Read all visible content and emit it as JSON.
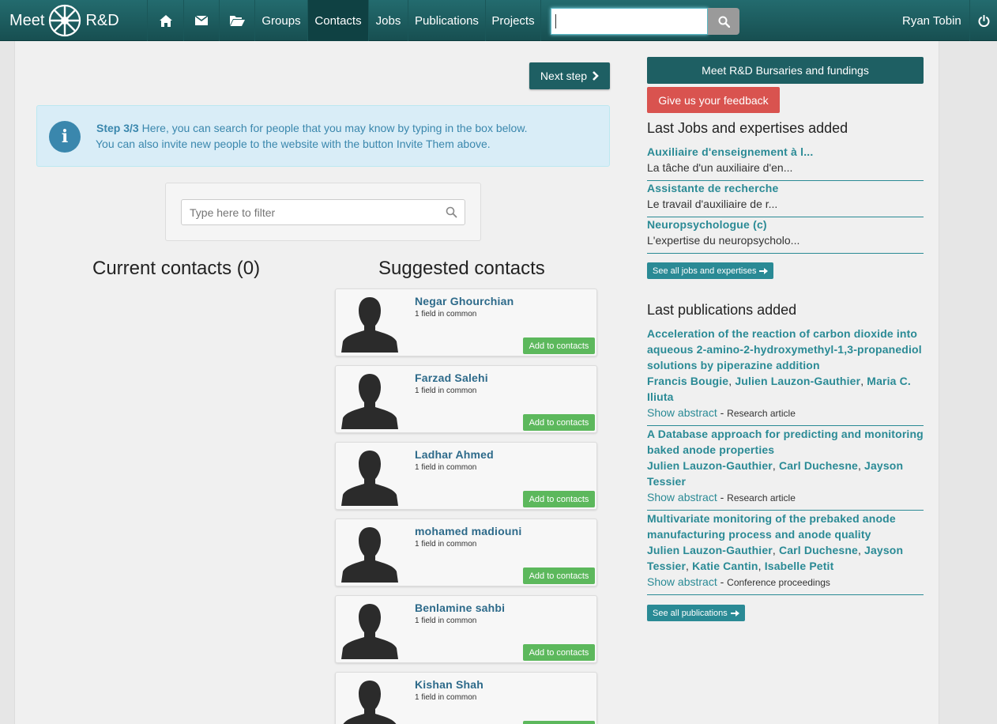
{
  "brand": {
    "left": "Meet",
    "right": "R&D"
  },
  "nav": {
    "icons": [
      "home-icon",
      "envelope-icon",
      "folder-open-icon"
    ],
    "items": [
      "Groups",
      "Contacts",
      "Jobs",
      "Publications",
      "Projects"
    ],
    "active": "Contacts",
    "search_value": "",
    "user": "Ryan Tobin"
  },
  "main": {
    "next_step": "Next step",
    "alert": {
      "step": "Step 3/3",
      "line1": " Here, you can search for people that you may know by typing in the box below.",
      "line2": "You can also invite new people to the website with the button Invite Them above."
    },
    "filter_placeholder": "Type here to filter",
    "current_heading": "Current contacts (0)",
    "suggested_heading": "Suggested contacts",
    "add_label": "Add to contacts",
    "contacts": [
      {
        "name": "Negar Ghourchian",
        "common": "1 field in common"
      },
      {
        "name": "Farzad Salehi",
        "common": "1 field in common"
      },
      {
        "name": "Ladhar Ahmed",
        "common": "1 field in common"
      },
      {
        "name": "mohamed madiouni",
        "common": "1 field in common"
      },
      {
        "name": "Benlamine sahbi",
        "common": "1 field in common"
      },
      {
        "name": "Kishan Shah",
        "common": "1 field in common"
      }
    ]
  },
  "sidebar": {
    "bursaries": "Meet R&D Bursaries and fundings",
    "feedback": "Give us your feedback",
    "jobs_heading": "Last Jobs and expertises added",
    "jobs": [
      {
        "title": "Auxiliaire d'enseignement à l...",
        "desc": "La tâche d'un auxiliaire d'en..."
      },
      {
        "title": "Assistante de recherche",
        "desc": "Le travail d'auxiliaire de r..."
      },
      {
        "title": "Neuropsychologue (c)",
        "desc": "L'expertise du neuropsycholo..."
      }
    ],
    "see_all_jobs": "See all jobs and expertises",
    "pubs_heading": "Last publications added",
    "show_abstract": "Show abstract",
    "pubs": [
      {
        "title": "Acceleration of the reaction of carbon dioxide into aqueous 2-amino-2-hydroxymethyl-1,3-propanediol solutions by piperazine addition",
        "authors": [
          "Francis Bougie",
          "Julien Lauzon-Gauthier",
          "Maria C. Iliuta"
        ],
        "type": "Research article"
      },
      {
        "title": "A Database approach for predicting and monitoring baked anode properties",
        "authors": [
          "Julien Lauzon-Gauthier",
          "Carl Duchesne",
          "Jayson Tessier"
        ],
        "type": "Research article"
      },
      {
        "title": "Multivariate monitoring of the prebaked anode manufacturing process and anode quality",
        "authors": [
          "Julien Lauzon-Gauthier",
          "Carl Duchesne",
          "Jayson Tessier",
          "Katie Cantin",
          "Isabelle Petit"
        ],
        "type": "Conference proceedings"
      }
    ],
    "see_all_pubs": "See all publications"
  }
}
